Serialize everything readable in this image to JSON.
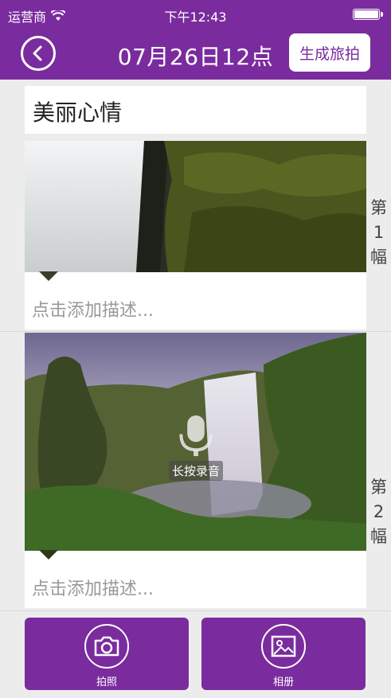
{
  "status": {
    "carrier": "运营商",
    "time": "下午12:43"
  },
  "nav": {
    "title": "07月26日12点",
    "generate_label": "生成旅拍"
  },
  "card": {
    "title": "美丽心情"
  },
  "photos": [
    {
      "side_label": [
        "第",
        "1",
        "幅"
      ],
      "placeholder": "点击添加描述..."
    },
    {
      "side_label": [
        "第",
        "2",
        "幅"
      ],
      "placeholder": "点击添加描述..."
    }
  ],
  "voice": {
    "label": "长按录音"
  },
  "bottom": {
    "camera_label": "拍照",
    "album_label": "相册"
  },
  "colors": {
    "brand": "#7a2c9e"
  },
  "icons": [
    "wifi-icon",
    "battery-icon",
    "back-icon",
    "microphone-icon",
    "camera-icon",
    "photo-album-icon"
  ]
}
